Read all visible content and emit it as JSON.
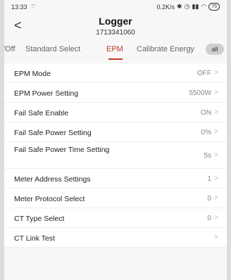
{
  "status_bar": {
    "time": "13:33",
    "network": "0.2K/s",
    "battery": "75"
  },
  "header": {
    "title": "Logger",
    "subtitle": "1713341060"
  },
  "tabs": [
    {
      "label": "/Off"
    },
    {
      "label": "Standard Select"
    },
    {
      "label": "EPM"
    },
    {
      "label": "Calibrate Energy"
    }
  ],
  "tab_all_label": "all",
  "active_tab": "EPM",
  "accent_color": "#c0392b",
  "settings": [
    {
      "label": "EPM Mode",
      "value": "OFF"
    },
    {
      "label": "EPM Power Setting",
      "value": "5500W"
    },
    {
      "label": "Fail Safe Enable",
      "value": "ON"
    },
    {
      "label": "Fail Safe Power Setting",
      "value": "0%"
    },
    {
      "label": "Fail Safe Power Time Setting",
      "value": "5s"
    },
    {
      "label": "Meter Address Settings",
      "value": "1"
    },
    {
      "label": "Meter Protocol Select",
      "value": "0"
    },
    {
      "label": "CT Type Select",
      "value": "0"
    },
    {
      "label": "CT Link Test",
      "value": ""
    }
  ]
}
